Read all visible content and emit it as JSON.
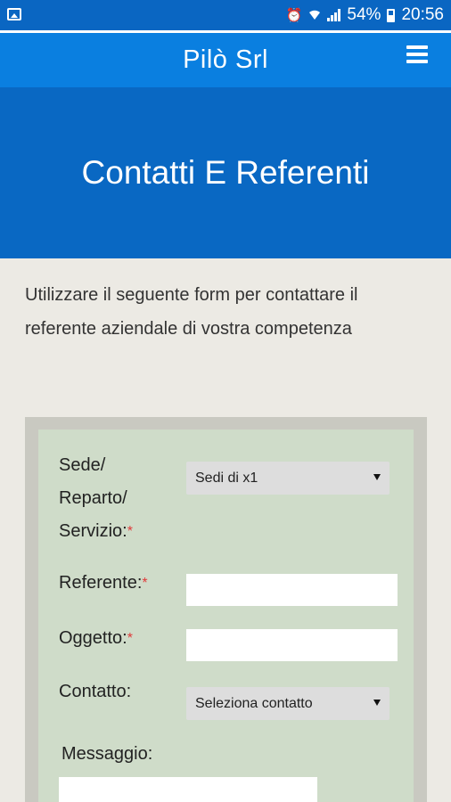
{
  "statusbar": {
    "battery_pct": "54%",
    "time": "20:56",
    "icons": [
      "image-icon",
      "alarm-icon",
      "wifi-icon",
      "signal-icon",
      "battery-icon"
    ]
  },
  "appbar": {
    "title": "Pilò Srl",
    "menu_icon": "hamburger-menu-icon"
  },
  "hero": {
    "title": "Contatti E Referenti"
  },
  "intro": {
    "text": "Utilizzare il seguente form per contattare il referente aziendale di vostra competenza"
  },
  "form": {
    "sede": {
      "label_line1": "Sede/",
      "label_line2": "Reparto/",
      "label_line3": "Servizio:",
      "required_mark": "*",
      "selected": "Sedi di x1"
    },
    "referente": {
      "label": "Referente:",
      "required_mark": "*",
      "value": ""
    },
    "oggetto": {
      "label": "Oggetto:",
      "required_mark": "*",
      "value": ""
    },
    "contatto": {
      "label": "Contatto:",
      "selected": "Seleziona contatto"
    },
    "messaggio": {
      "label": "Messaggio:",
      "value": ""
    }
  },
  "colors": {
    "statusbar": "#0a66c2",
    "appbar": "#0a7fe0",
    "hero": "#0968c3",
    "page_bg": "#eceae4",
    "form_bg": "#cfdcc9",
    "required": "#e03a3a"
  }
}
